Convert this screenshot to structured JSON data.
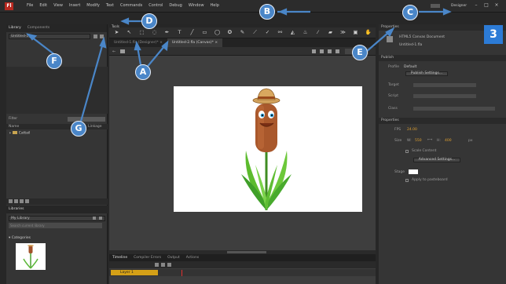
{
  "app": {
    "logo": "Fl"
  },
  "menu": [
    "File",
    "Edit",
    "View",
    "Insert",
    "Modify",
    "Text",
    "Commands",
    "Control",
    "Debug",
    "Window",
    "Help"
  ],
  "workspace": {
    "layout": "Designer"
  },
  "left_panel": {
    "tabs": [
      "Library",
      "Components"
    ],
    "doc_dropdown": "Untitled-10",
    "filter_label": "Filter",
    "name_header": "Name",
    "name_header_right": "Linkage",
    "folder": "Cattail",
    "lib2_tab": "Libraries",
    "my_library": "My Library",
    "search_placeholder": "Search current library",
    "category": "Categories"
  },
  "document": {
    "tools_tab": "Tools",
    "tabs": [
      "Untitled-1.fla (Designer)*",
      "Untitled-2.fla (Canvas)*"
    ],
    "timeline_tabs": [
      "Timeline",
      "Compiler Errors",
      "Output",
      "Actions"
    ],
    "layer_name": "Layer 1"
  },
  "properties": {
    "tab": "Properties",
    "doc_type": "HTML5 Canvas Document",
    "doc_name": "Untitled-1.fla",
    "publish_section": "Publish",
    "profile_label": "Profile",
    "profile_value": "Default",
    "publish_settings_btn": "Publish Settings...",
    "target_label": "Target",
    "script_label": "Script",
    "class_label": "Class",
    "properties_section": "Properties",
    "fps_label": "FPS",
    "fps_value": "24.00",
    "size_label": "Size",
    "size_w_label": "W:",
    "size_w": "550",
    "size_h_label": "H:",
    "size_h": "400",
    "size_unit": "px",
    "scale_content": "Scale Content",
    "advanced_settings_btn": "Advanced Settings...",
    "stage_label": "Stage",
    "apply_pasteboard": "Apply to pasteboard"
  },
  "annotations": {
    "A": "A",
    "B": "B",
    "C": "C",
    "D": "D",
    "E": "E",
    "F": "F",
    "G": "G",
    "three": "3"
  },
  "colors": {
    "accent_blue": "#4a86c8",
    "layer_yellow": "#d4a017",
    "logo_red": "#b8281f"
  }
}
